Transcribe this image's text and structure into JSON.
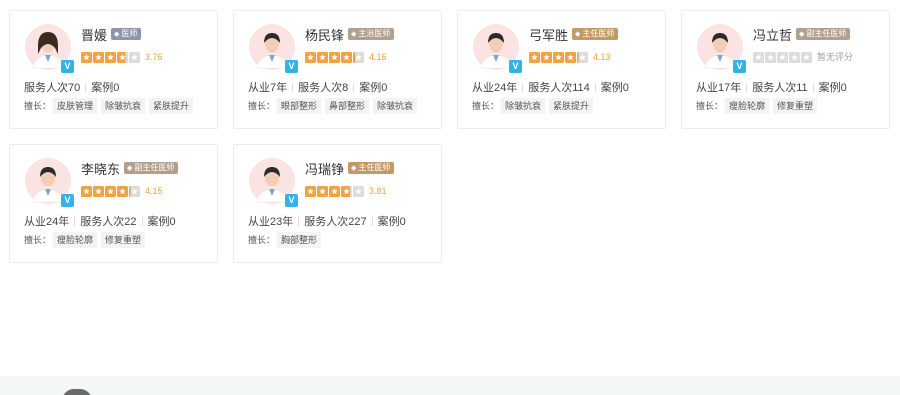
{
  "colors": {
    "star_filled": "#f0a33e",
    "star_empty": "#dcdcdc",
    "score": "#f0a33e",
    "tag_doctor": "#8d94ad",
    "tag_attending": "#b2a08d",
    "tag_chief": "#c29a66",
    "tag_associate_chief": "#b2a08d",
    "verified_badge": "#2fb3e8"
  },
  "skills_label": "擅长：",
  "doctors": [
    {
      "name": "晋媛",
      "title": "医师",
      "rating": 3.76,
      "score_text": "3.76",
      "stats": [
        "服务人次70",
        "案例0"
      ],
      "skills": [
        "皮肤管理",
        "除皱抗衰",
        "紧肤提升"
      ],
      "gender": "female",
      "verified_icon": "V"
    },
    {
      "name": "杨民锋",
      "title": "主治医师",
      "rating": 4.16,
      "score_text": "4.16",
      "stats": [
        "从业7年",
        "服务人次8",
        "案例0"
      ],
      "skills": [
        "眼部整形",
        "鼻部整形",
        "除皱抗衰"
      ],
      "gender": "male",
      "verified_icon": "V"
    },
    {
      "name": "弓军胜",
      "title": "主任医师",
      "rating": 4.13,
      "score_text": "4.13",
      "stats": [
        "从业24年",
        "服务人次114",
        "案例0"
      ],
      "skills": [
        "除皱抗衰",
        "紧肤提升"
      ],
      "gender": "male",
      "verified_icon": "V"
    },
    {
      "name": "冯立哲",
      "title": "副主任医师",
      "rating": 0,
      "score_text": "暂无评分",
      "stats": [
        "从业17年",
        "服务人次11",
        "案例0"
      ],
      "skills": [
        "瘦脸轮廓",
        "修复重塑"
      ],
      "gender": "male",
      "verified_icon": "V"
    },
    {
      "name": "李晓东",
      "title": "副主任医师",
      "rating": 4.15,
      "score_text": "4.15",
      "stats": [
        "从业24年",
        "服务人次22",
        "案例0"
      ],
      "skills": [
        "瘦脸轮廓",
        "修复重塑"
      ],
      "gender": "male",
      "verified_icon": "V"
    },
    {
      "name": "冯瑞铮",
      "title": "主任医师",
      "rating": 3.81,
      "score_text": "3.81",
      "stats": [
        "从业23年",
        "服务人次227",
        "案例0"
      ],
      "skills": [
        "胸部整形"
      ],
      "gender": "male",
      "verified_icon": "V"
    }
  ]
}
